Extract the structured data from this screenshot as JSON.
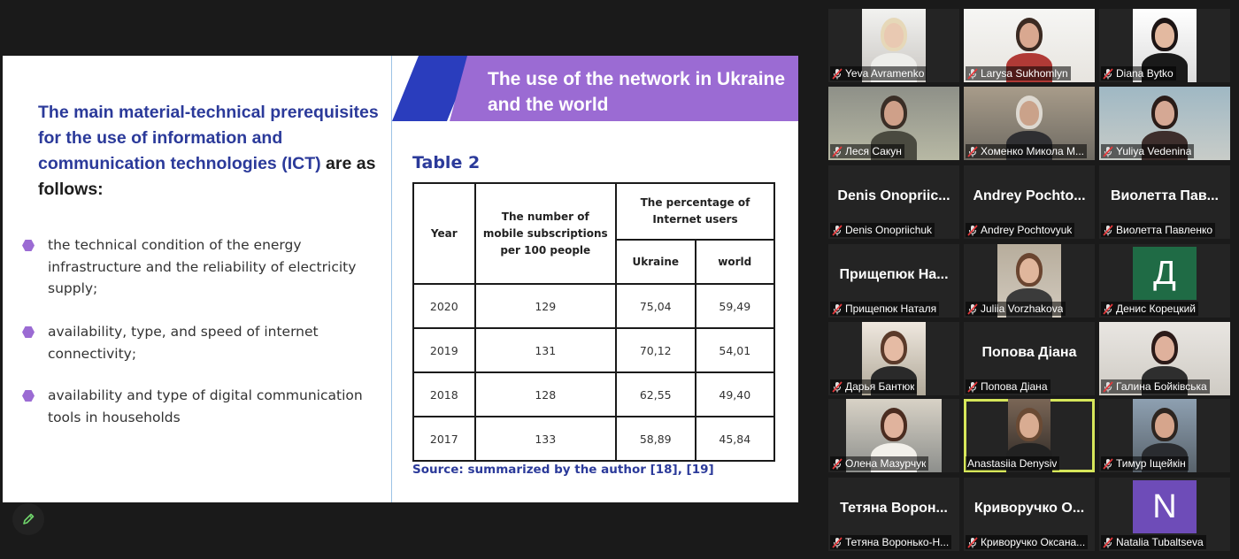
{
  "slide": {
    "left": {
      "heading_main": "The main material-technical prerequisites for the use of information and communication technologies (ICT)",
      "heading_tail": " are as follows:",
      "bullets": [
        "the technical condition of the energy infrastructure and the reliability of electricity supply;",
        "availability, type, and speed of internet connectivity;",
        " availability and type of digital communication tools in households"
      ]
    },
    "right": {
      "banner_title": "The use of the network in Ukraine and the world",
      "table_caption": "Table 2",
      "table": {
        "headers": {
          "year": "Year",
          "subscriptions": "The number of mobile subscriptions per 100 people",
          "percentage": "The percentage of Internet users",
          "ukraine": "Ukraine",
          "world": "world"
        },
        "rows": [
          [
            "2020",
            "129",
            "75,04",
            "59,49"
          ],
          [
            "2019",
            "131",
            "70,12",
            "54,01"
          ],
          [
            "2018",
            "128",
            "62,55",
            "49,40"
          ],
          [
            "2017",
            "133",
            "58,89",
            "45,84"
          ]
        ]
      },
      "source": "Source: summarized by the author [18], [19]"
    },
    "colors": {
      "navy": "#2b3a9a",
      "blue": "#2a3dbd",
      "purple": "#9b6bd3"
    }
  },
  "annotate_icon": "pencil-icon",
  "participants": [
    {
      "name": "Yeva Avramenko",
      "type": "video",
      "muted": true
    },
    {
      "name": "Larysa Sukhomlyn",
      "type": "video",
      "muted": true
    },
    {
      "name": "Diana Bytko",
      "type": "video",
      "muted": true
    },
    {
      "name": "Леся Сакун",
      "type": "video",
      "muted": true
    },
    {
      "name": "Хоменко Микола М...",
      "type": "video",
      "muted": true
    },
    {
      "name": "Yuliya Vedenina",
      "type": "video",
      "muted": true
    },
    {
      "name": "Denis Onopriichuk",
      "display": "Denis Onopriic...",
      "type": "name",
      "muted": true
    },
    {
      "name": "Andrey Pochtovyuk",
      "display": "Andrey Pochto...",
      "type": "name",
      "muted": true
    },
    {
      "name": "Виолетта Павленко",
      "display": "Виолетта Пав...",
      "type": "name",
      "muted": true
    },
    {
      "name": "Прищепюк Наталя",
      "display": "Прищепюк На...",
      "type": "name",
      "muted": true
    },
    {
      "name": "Juliia Vorzhakova",
      "type": "video",
      "muted": true
    },
    {
      "name": "Денис Корецкий",
      "type": "avatar",
      "initial": "Д",
      "avatar_color": "#1f6b45",
      "muted": true
    },
    {
      "name": "Дарья Бантюк",
      "type": "video",
      "muted": true
    },
    {
      "name": "Попова Діана",
      "display": "Попова Діана",
      "type": "name",
      "muted": true
    },
    {
      "name": "Галина Бойківська",
      "type": "video",
      "muted": true
    },
    {
      "name": "Олена Мазурчук",
      "type": "video",
      "muted": true
    },
    {
      "name": "Anastasiia Denysiv",
      "type": "video",
      "muted": false,
      "active": true
    },
    {
      "name": "Тимур Іщейкін",
      "type": "video",
      "muted": true
    },
    {
      "name": "Тетяна Воронько-Н...",
      "display": "Тетяна Ворон...",
      "type": "name",
      "muted": true
    },
    {
      "name": "Криворучко Оксана...",
      "display": "Криворучко О...",
      "type": "name",
      "muted": true
    },
    {
      "name": "Natalia Tubaltseva",
      "type": "avatar",
      "initial": "N",
      "avatar_color": "#6e4cb8",
      "muted": true
    }
  ]
}
